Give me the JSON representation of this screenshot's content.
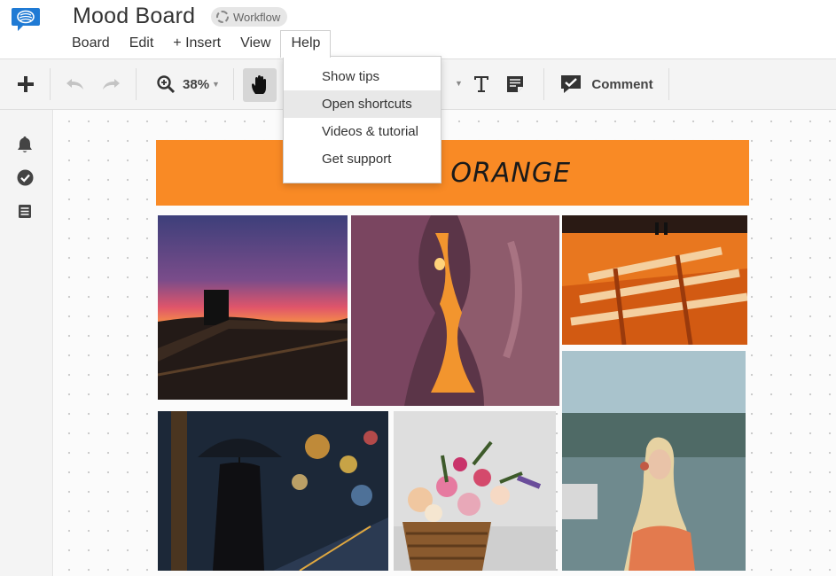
{
  "app": {
    "title": "Mood Board",
    "workflow_label": "Workflow"
  },
  "menubar": {
    "items": [
      "Board",
      "Edit",
      "+ Insert",
      "View",
      "Help"
    ],
    "active": "Help"
  },
  "help_menu": {
    "items": [
      "Show tips",
      "Open shortcuts",
      "Videos & tutorial",
      "Get support"
    ],
    "highlighted": "Open shortcuts"
  },
  "toolbar": {
    "zoom": "38%",
    "comment_label": "Comment",
    "icons": [
      "plus-icon",
      "undo-icon",
      "redo-icon",
      "zoom-icon",
      "hand-tool-icon",
      "text-tool-icon",
      "note-icon",
      "comment-icon"
    ]
  },
  "leftrail": {
    "icons": [
      "bell-icon",
      "check-circle-icon",
      "list-icon"
    ]
  },
  "board": {
    "banner_text": "COLOR: ORANGE",
    "banner_color": "#f98a25",
    "photos": [
      "sunset-fence",
      "slot-canyon",
      "orange-corridor",
      "umbrella-street",
      "flower-basket",
      "woman-headphones"
    ]
  },
  "colors": {
    "accent": "#1f7ad4",
    "toolbar_bg": "#f4f4f4",
    "banner": "#f98a25"
  }
}
